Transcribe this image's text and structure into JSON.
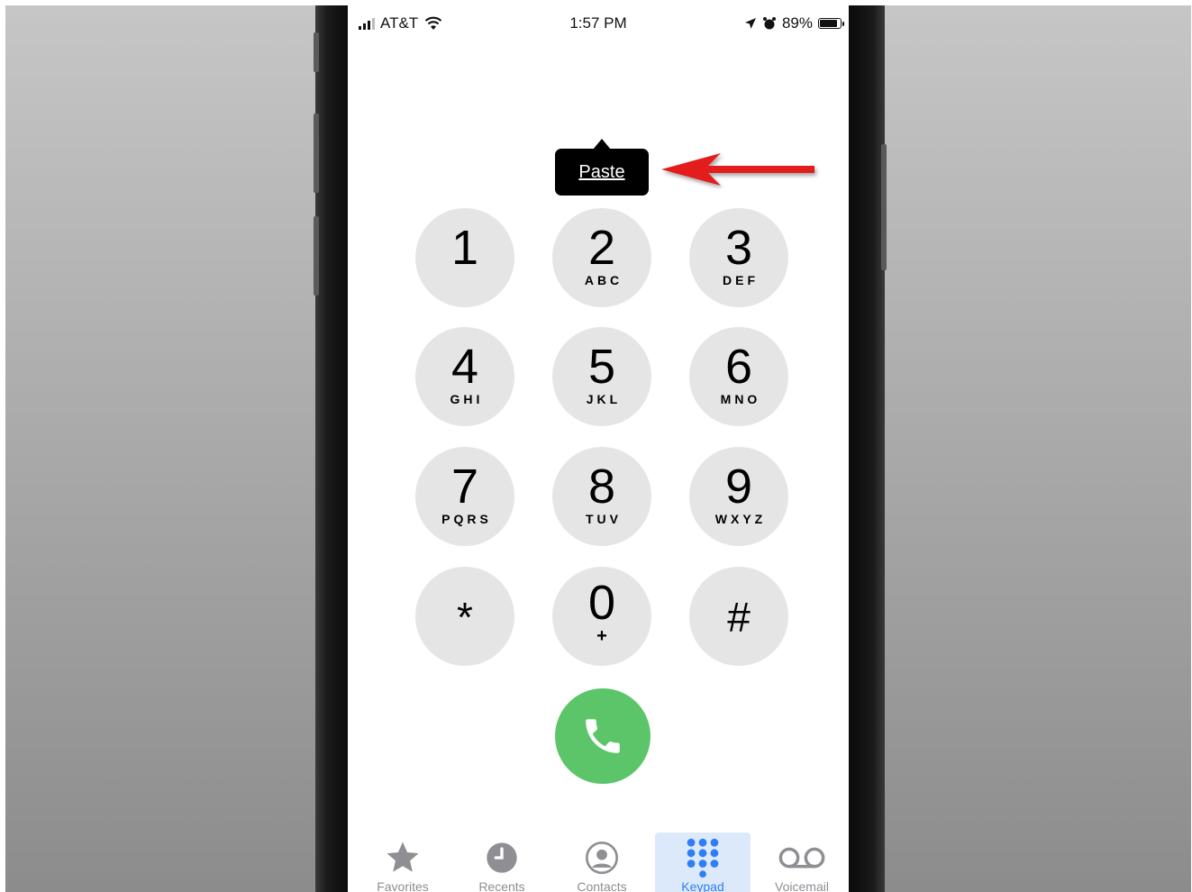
{
  "status_bar": {
    "carrier": "AT&T",
    "time": "1:57 PM",
    "battery": "89%"
  },
  "popup": {
    "label": "Paste"
  },
  "keypad": {
    "keys": [
      {
        "digit": "1",
        "letters": ""
      },
      {
        "digit": "2",
        "letters": "ABC"
      },
      {
        "digit": "3",
        "letters": "DEF"
      },
      {
        "digit": "4",
        "letters": "GHI"
      },
      {
        "digit": "5",
        "letters": "JKL"
      },
      {
        "digit": "6",
        "letters": "MNO"
      },
      {
        "digit": "7",
        "letters": "PQRS"
      },
      {
        "digit": "8",
        "letters": "TUV"
      },
      {
        "digit": "9",
        "letters": "WXYZ"
      },
      {
        "digit": "*",
        "letters": ""
      },
      {
        "digit": "0",
        "letters": "+"
      },
      {
        "digit": "#",
        "letters": ""
      }
    ]
  },
  "tab_bar": {
    "tabs": [
      {
        "label": "Favorites",
        "icon": "star-icon"
      },
      {
        "label": "Recents",
        "icon": "clock-icon"
      },
      {
        "label": "Contacts",
        "icon": "person-circle-icon"
      },
      {
        "label": "Keypad",
        "icon": "keypad-grid-icon",
        "active": true
      },
      {
        "label": "Voicemail",
        "icon": "voicemail-icon"
      }
    ]
  },
  "colors": {
    "call_green": "#5cc56a",
    "key_gray": "#e5e5e5",
    "active_tab_blue": "#2f7ef6",
    "annotation_red": "#e31b1b"
  }
}
